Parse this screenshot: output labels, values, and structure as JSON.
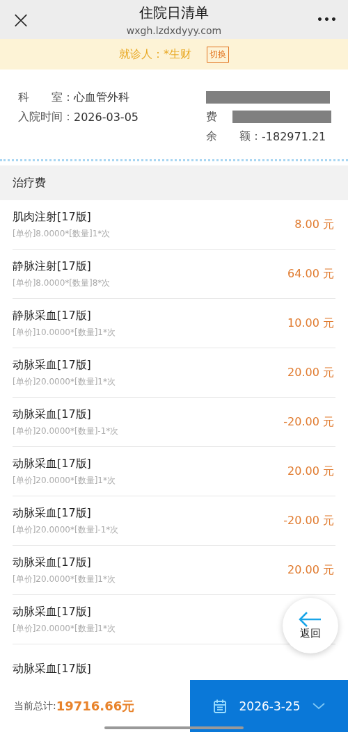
{
  "header": {
    "close": "×",
    "title": "住院日清单",
    "url": "wxgh.lzdxdyyy.com",
    "more": "•••"
  },
  "patient_bar": {
    "label": "就诊人：*生财",
    "switch_button": "切换"
  },
  "info": {
    "left": [
      {
        "label": "科　　室：",
        "value": "心血管外科"
      },
      {
        "label": "入院时间：",
        "value": "2026-03-05"
      }
    ],
    "right": [
      {
        "kind": "redacted"
      },
      {
        "kind": "redacted",
        "label": "费"
      },
      {
        "kind": "text",
        "label": "余　　额：",
        "value": "-182971.21"
      }
    ]
  },
  "section": {
    "title": "治疗费"
  },
  "items": [
    {
      "name": "肌肉注射[17版]",
      "detail": "[单价]8.0000*[数量]1*次",
      "amount": "8.00 元"
    },
    {
      "name": "静脉注射[17版]",
      "detail": "[单价]8.0000*[数量]8*次",
      "amount": "64.00 元"
    },
    {
      "name": "静脉采血[17版]",
      "detail": "[单价]10.0000*[数量]1*次",
      "amount": "10.00 元"
    },
    {
      "name": "动脉采血[17版]",
      "detail": "[单价]20.0000*[数量]1*次",
      "amount": "20.00 元"
    },
    {
      "name": "动脉采血[17版]",
      "detail": "[单价]20.0000*[数量]-1*次",
      "amount": "-20.00 元"
    },
    {
      "name": "动脉采血[17版]",
      "detail": "[单价]20.0000*[数量]1*次",
      "amount": "20.00 元"
    },
    {
      "name": "动脉采血[17版]",
      "detail": "[单价]20.0000*[数量]-1*次",
      "amount": "-20.00 元"
    },
    {
      "name": "动脉采血[17版]",
      "detail": "[单价]20.0000*[数量]1*次",
      "amount": "20.00 元"
    },
    {
      "name": "动脉采血[17版]",
      "detail": "[单价]20.0000*[数量]1*次"
    },
    {
      "name": "动脉采血[17版]"
    }
  ],
  "back_button": {
    "label": "返回"
  },
  "footer": {
    "total_label": "当前总计:",
    "total_value": "19716.66元",
    "date": "2026-3-25"
  }
}
